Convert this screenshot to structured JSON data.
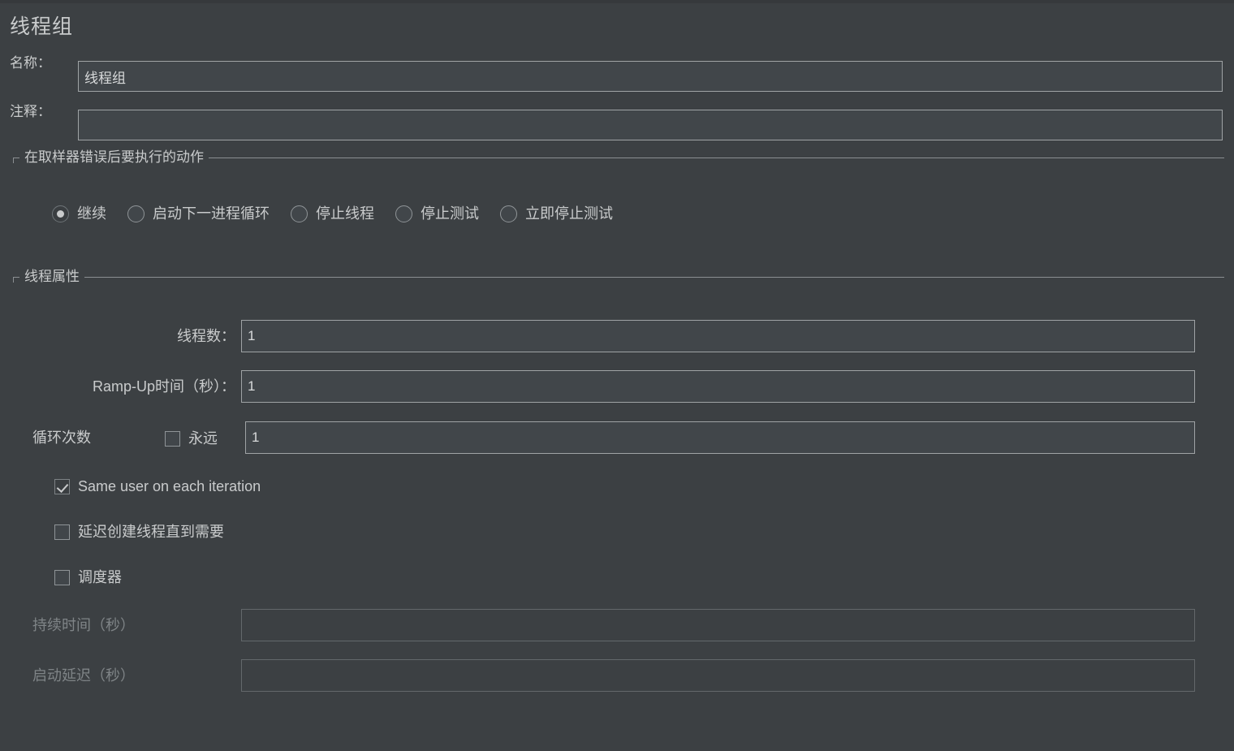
{
  "window": {
    "title": "线程组"
  },
  "name_row": {
    "label": "名称：",
    "value": "线程组"
  },
  "comment_row": {
    "label": "注释：",
    "value": "",
    "placeholder": ""
  },
  "error_action_group": {
    "legend": "在取样器错误后要执行的动作",
    "options": [
      {
        "label": "继续",
        "checked": true
      },
      {
        "label": "启动下一进程循环",
        "checked": false
      },
      {
        "label": "停止线程",
        "checked": false
      },
      {
        "label": "停止测试",
        "checked": false
      },
      {
        "label": "立即停止测试",
        "checked": false
      }
    ]
  },
  "thread_properties": {
    "legend": "线程属性",
    "num_threads": {
      "label": "线程数：",
      "value": "1"
    },
    "ramp_up": {
      "label": "Ramp-Up时间（秒）：",
      "value": "1"
    },
    "loop_count": {
      "label": "循环次数",
      "forever_label": "永远",
      "forever_checked": false,
      "value": "1"
    },
    "same_user": {
      "label": "Same user on each iteration",
      "checked": true
    },
    "delayed_start": {
      "label": "延迟创建线程直到需要",
      "checked": false
    },
    "scheduler": {
      "label": "调度器",
      "checked": false
    },
    "duration": {
      "label": "持续时间（秒）",
      "value": "",
      "disabled": true
    },
    "startup_delay": {
      "label": "启动延迟（秒）",
      "value": "",
      "disabled": true
    }
  },
  "colors": {
    "background": "#3c4043",
    "text": "#c9cbcc",
    "input_background": "#41464a",
    "input_border": "#9fa3a5",
    "disabled_text": "#7f8487",
    "group_border": "#8b8f92"
  }
}
